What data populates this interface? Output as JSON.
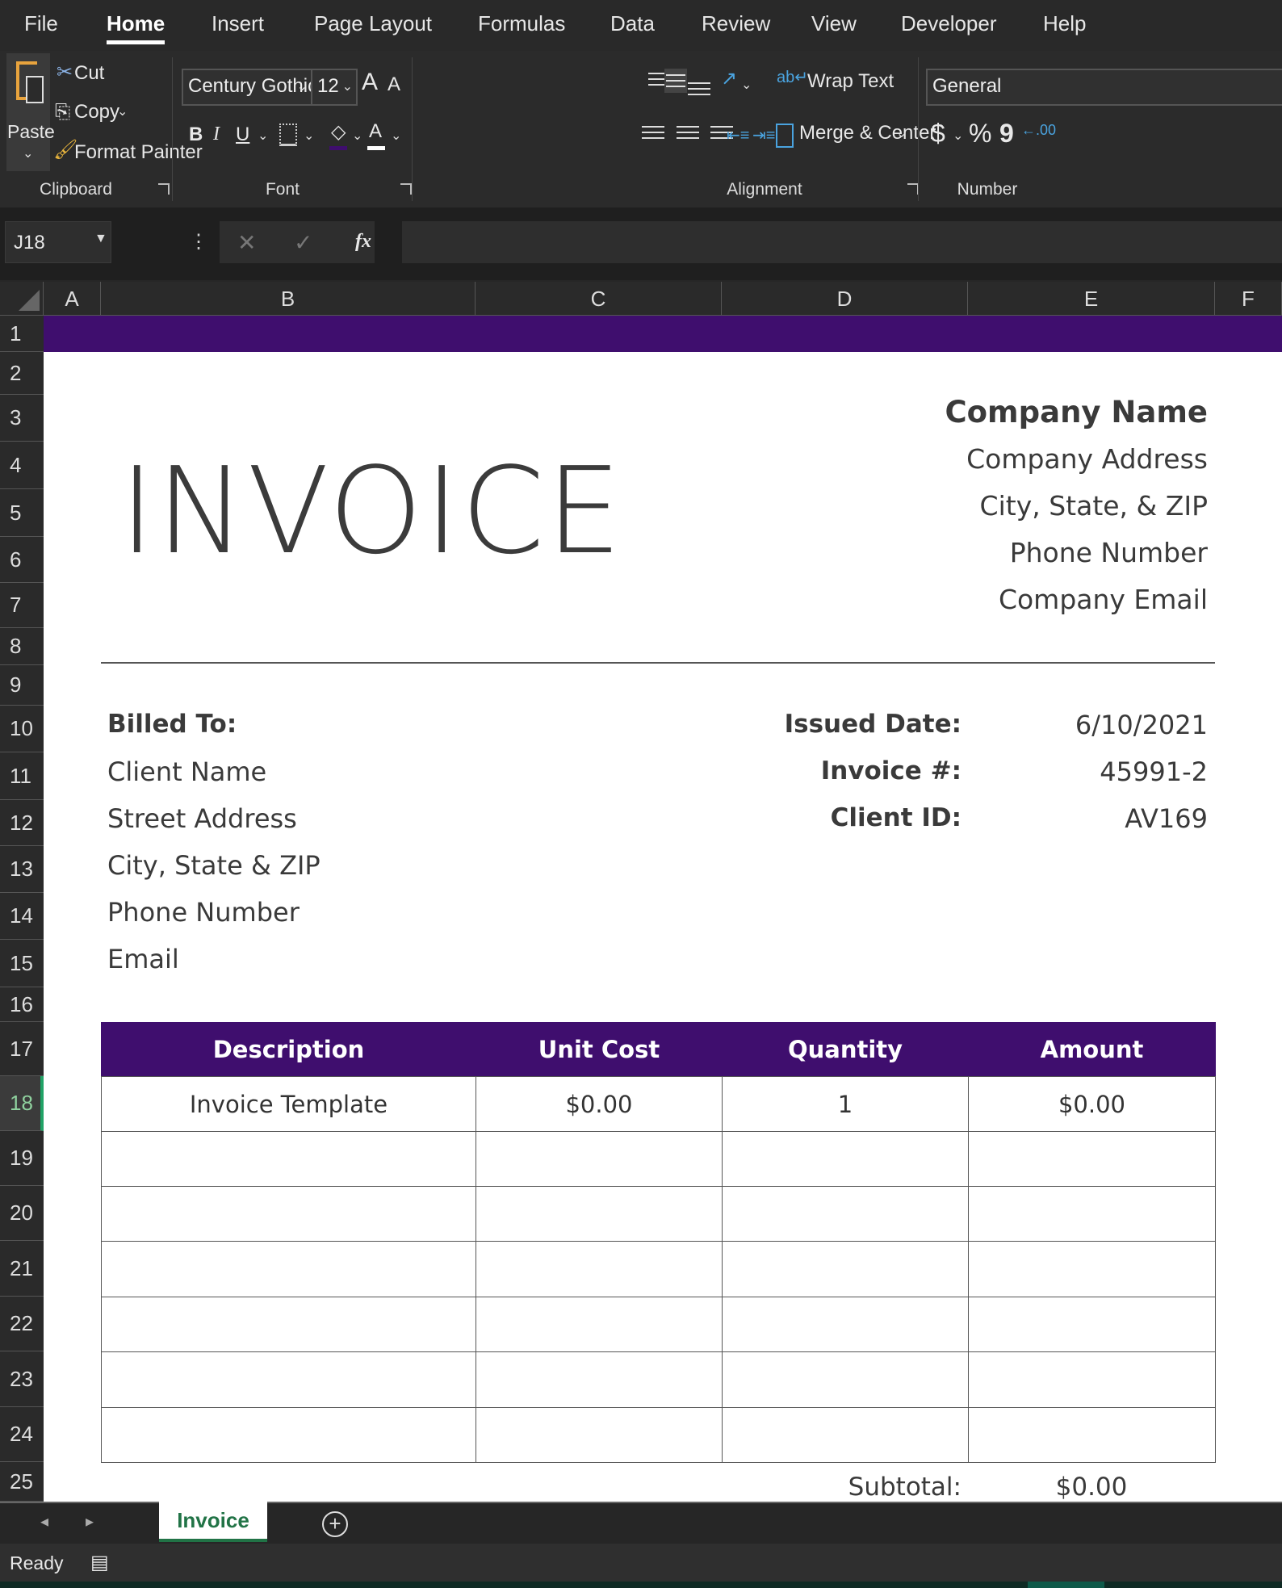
{
  "menu": {
    "tabs": [
      "File",
      "Home",
      "Insert",
      "Page Layout",
      "Formulas",
      "Data",
      "Review",
      "View",
      "Developer",
      "Help"
    ],
    "active": "Home"
  },
  "ribbon": {
    "clipboard": {
      "paste": "Paste",
      "cut": "Cut",
      "copy": "Copy",
      "format_painter": "Format Painter",
      "label": "Clipboard"
    },
    "font": {
      "name": "Century Gothic",
      "size": "12",
      "bold": "B",
      "italic": "I",
      "underline": "U",
      "grow": "A",
      "shrink": "A",
      "font_color": "A",
      "label": "Font",
      "fill_color": "#3f0e6e"
    },
    "alignment": {
      "wrap_text": "Wrap Text",
      "merge_center": "Merge & Center",
      "label": "Alignment"
    },
    "number": {
      "format": "General",
      "currency": "$",
      "percent": "%",
      "comma": "9",
      "label": "Number"
    }
  },
  "formula_bar": {
    "name_box": "J18",
    "fx": "fx",
    "formula": ""
  },
  "columns": [
    "A",
    "B",
    "C",
    "D",
    "E",
    "F"
  ],
  "rows": [
    "1",
    "2",
    "3",
    "4",
    "5",
    "6",
    "7",
    "8",
    "9",
    "10",
    "11",
    "12",
    "13",
    "14",
    "15",
    "16",
    "17",
    "18",
    "19",
    "20",
    "21",
    "22",
    "23",
    "24",
    "25"
  ],
  "selected_row": "18",
  "invoice": {
    "title": "INVOICE",
    "company": {
      "name": "Company Name",
      "address": "Company Address",
      "city": "City, State, & ZIP",
      "phone": "Phone Number",
      "email": "Company Email"
    },
    "billed_to": {
      "label": "Billed To:",
      "name": "Client Name",
      "street": "Street Address",
      "city": "City, State & ZIP",
      "phone": "Phone Number",
      "email": "Email"
    },
    "meta": [
      {
        "label": "Issued Date:",
        "value": "6/10/2021"
      },
      {
        "label": "Invoice #:",
        "value": "45991-2"
      },
      {
        "label": "Client ID:",
        "value": "AV169"
      }
    ],
    "table": {
      "headers": [
        "Description",
        "Unit Cost",
        "Quantity",
        "Amount"
      ],
      "rows": [
        [
          "Invoice Template",
          "$0.00",
          "1",
          "$0.00"
        ],
        [
          "",
          "",
          "",
          ""
        ],
        [
          "",
          "",
          "",
          ""
        ],
        [
          "",
          "",
          "",
          ""
        ],
        [
          "",
          "",
          "",
          ""
        ],
        [
          "",
          "",
          "",
          ""
        ],
        [
          "",
          "",
          "",
          ""
        ]
      ]
    },
    "subtotal": {
      "label": "Subtotal:",
      "value": "$0.00"
    },
    "accent": "#3f0e6e"
  },
  "sheet_tabs": {
    "active": "Invoice"
  },
  "status": {
    "text": "Ready"
  }
}
